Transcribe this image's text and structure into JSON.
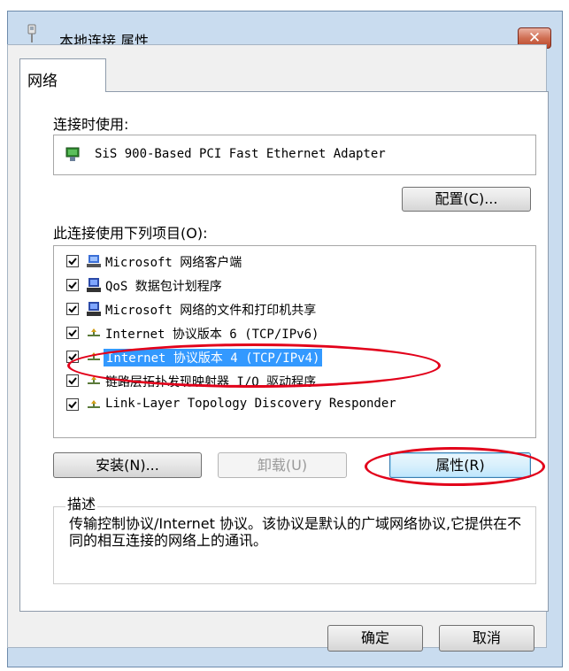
{
  "window": {
    "title": "本地连接 属性",
    "close_label": "✕"
  },
  "tabs": [
    {
      "label": "网络"
    }
  ],
  "connect_using": {
    "label": "连接时使用:",
    "adapter_name": "SiS 900-Based PCI Fast Ethernet Adapter",
    "configure_label": "配置(C)..."
  },
  "items_section": {
    "label": "此连接使用下列项目(O):",
    "items": [
      {
        "label": "Microsoft 网络客户端",
        "checked": true,
        "icon": "network-client-icon"
      },
      {
        "label": "QoS 数据包计划程序",
        "checked": true,
        "icon": "qos-icon"
      },
      {
        "label": "Microsoft 网络的文件和打印机共享",
        "checked": true,
        "icon": "file-share-icon"
      },
      {
        "label": "Internet 协议版本 6 (TCP/IPv6)",
        "checked": true,
        "icon": "protocol-icon"
      },
      {
        "label": "Internet 协议版本 4 (TCP/IPv4)",
        "checked": true,
        "icon": "protocol-icon",
        "selected": true
      },
      {
        "label": "链路层拓扑发现映射器 I/O 驱动程序",
        "checked": true,
        "icon": "protocol-icon"
      },
      {
        "label": "Link-Layer Topology Discovery Responder",
        "checked": true,
        "icon": "protocol-icon"
      }
    ]
  },
  "actions": {
    "install_label": "安装(N)...",
    "uninstall_label": "卸载(U)",
    "properties_label": "属性(R)"
  },
  "description": {
    "title": "描述",
    "text": "传输控制协议/Internet 协议。该协议是默认的广域网络协议,它提供在不同的相互连接的网络上的通讯。"
  },
  "footer": {
    "ok_label": "确定",
    "cancel_label": "取消"
  },
  "colors": {
    "annotation": "#e2001a",
    "selection": "#3399ff",
    "frame": "#c9dcef"
  }
}
